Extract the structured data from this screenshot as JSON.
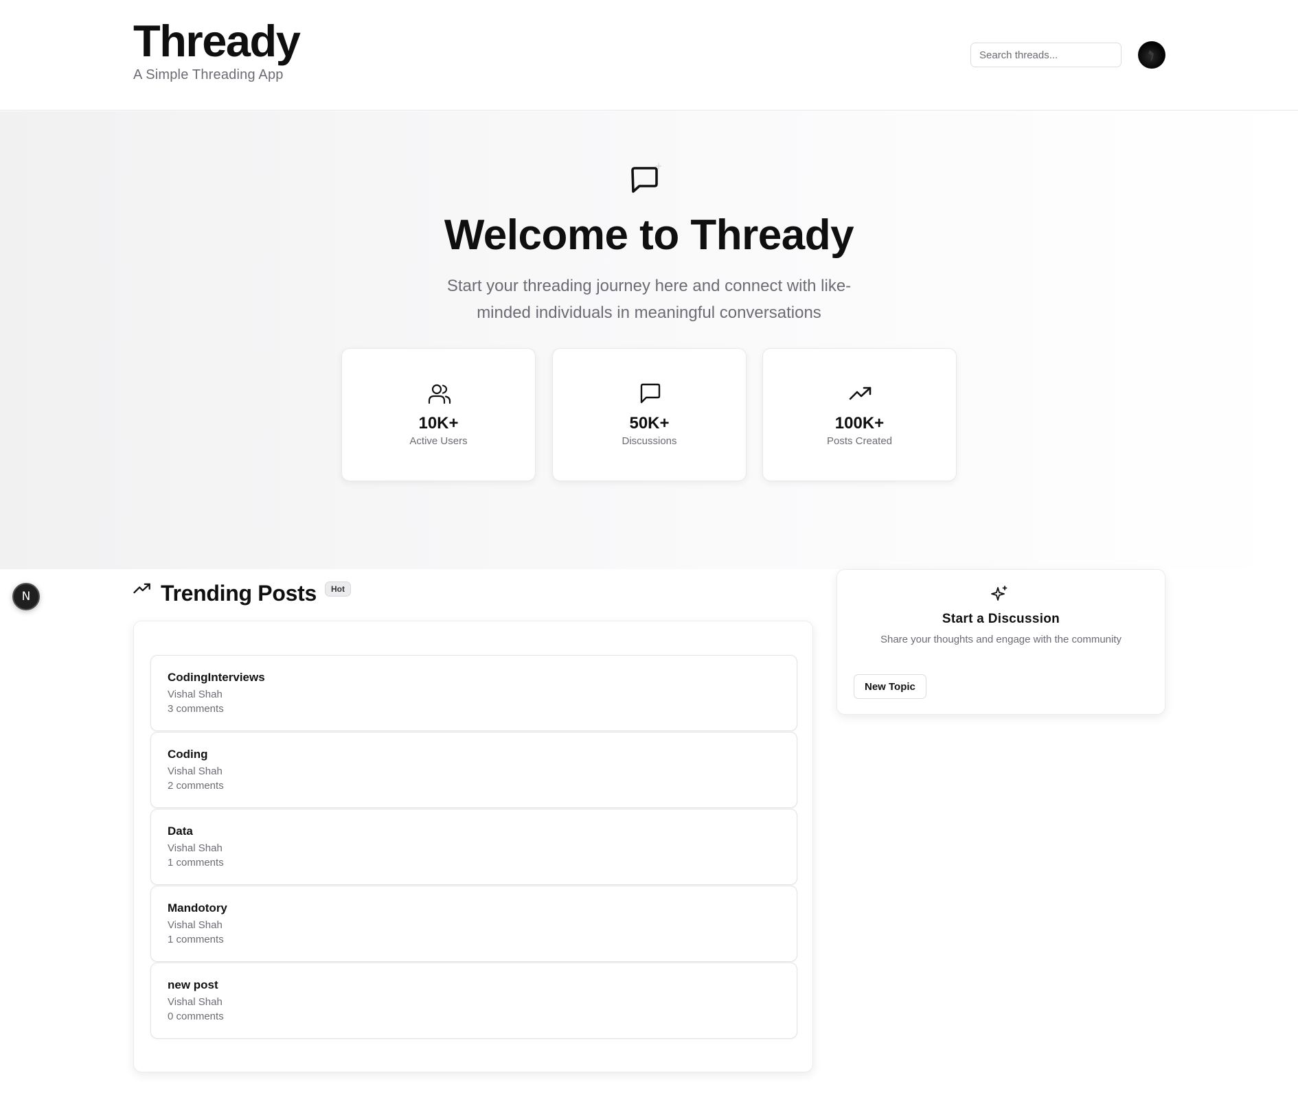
{
  "header": {
    "title": "Thready",
    "subtitle": "A Simple Threading App",
    "search_placeholder": "Search threads...",
    "avatar_icon": "user-avatar"
  },
  "hero": {
    "icon": "message-square-icon",
    "title": "Welcome to Thready",
    "subtitle": "Start your threading journey here and connect with like-minded individuals in meaningful conversations",
    "stats": [
      {
        "icon": "users-icon",
        "value": "10K+",
        "label": "Active Users"
      },
      {
        "icon": "message-square-icon",
        "value": "50K+",
        "label": "Discussions"
      },
      {
        "icon": "trending-up-icon",
        "value": "100K+",
        "label": "Posts Created"
      }
    ]
  },
  "trending": {
    "title": "Trending Posts",
    "badge": "Hot",
    "posts": [
      {
        "title": "CodingInterviews",
        "author": "Vishal Shah",
        "comments": "3 comments"
      },
      {
        "title": "Coding",
        "author": "Vishal Shah",
        "comments": "2 comments"
      },
      {
        "title": "Data",
        "author": "Vishal Shah",
        "comments": "1 comments"
      },
      {
        "title": "Mandotory",
        "author": "Vishal Shah",
        "comments": "1 comments"
      },
      {
        "title": "new post",
        "author": "Vishal Shah",
        "comments": "0 comments"
      }
    ]
  },
  "discussion": {
    "icon": "sparkles-icon",
    "title": "Start a Discussion",
    "subtitle": "Share your thoughts and engage with the community",
    "button_label": "New Topic"
  },
  "dev_badge": {
    "label": "N"
  },
  "colors": {
    "text": "#0f0f10",
    "muted": "#6b6b73",
    "border": "#e6e6e8",
    "accent": "#000000"
  }
}
